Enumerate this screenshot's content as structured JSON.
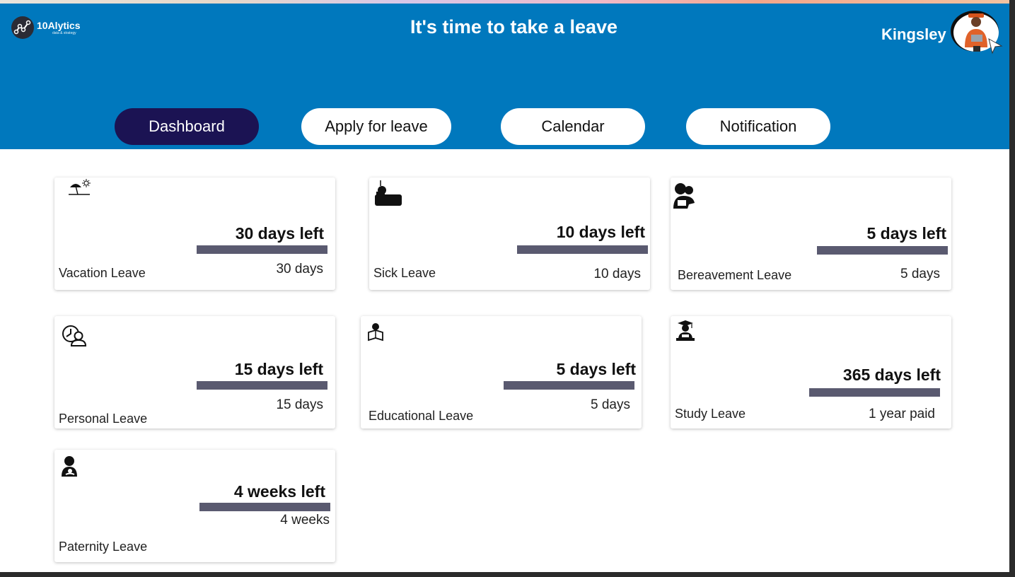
{
  "header": {
    "logo_name": "10Alytics",
    "logo_tagline": "data & strategy",
    "title": "It's time to take a leave",
    "user_name": "Kingsley"
  },
  "nav": {
    "dashboard": "Dashboard",
    "apply": "Apply  for leave",
    "calendar": "Calendar",
    "notification": "Notification"
  },
  "cards": [
    {
      "label": "Vacation Leave",
      "left": "30 days left",
      "total": "30 days",
      "icon": "beach-umbrella-icon"
    },
    {
      "label": "Sick Leave",
      "left": "10 days left",
      "total": "10 days",
      "icon": "sick-bed-icon"
    },
    {
      "label": "Bereavement Leave",
      "left": "5 days left",
      "total": "5 days",
      "icon": "mourning-people-icon"
    },
    {
      "label": "Personal Leave",
      "left": "15 days left",
      "total": "15 days",
      "icon": "person-clock-icon"
    },
    {
      "label": "Educational Leave",
      "left": "5 days left",
      "total": "5 days",
      "icon": "reading-person-icon"
    },
    {
      "label": "Study Leave",
      "left": "365 days left",
      "total": "1 year paid",
      "icon": "graduate-icon"
    },
    {
      "label": "Paternity Leave",
      "left": "4 weeks left",
      "total": "4 weeks",
      "icon": "parent-child-icon"
    }
  ],
  "colors": {
    "header_bg": "#0078bd",
    "active_nav": "#1b1353",
    "bar": "#5a5a70"
  }
}
